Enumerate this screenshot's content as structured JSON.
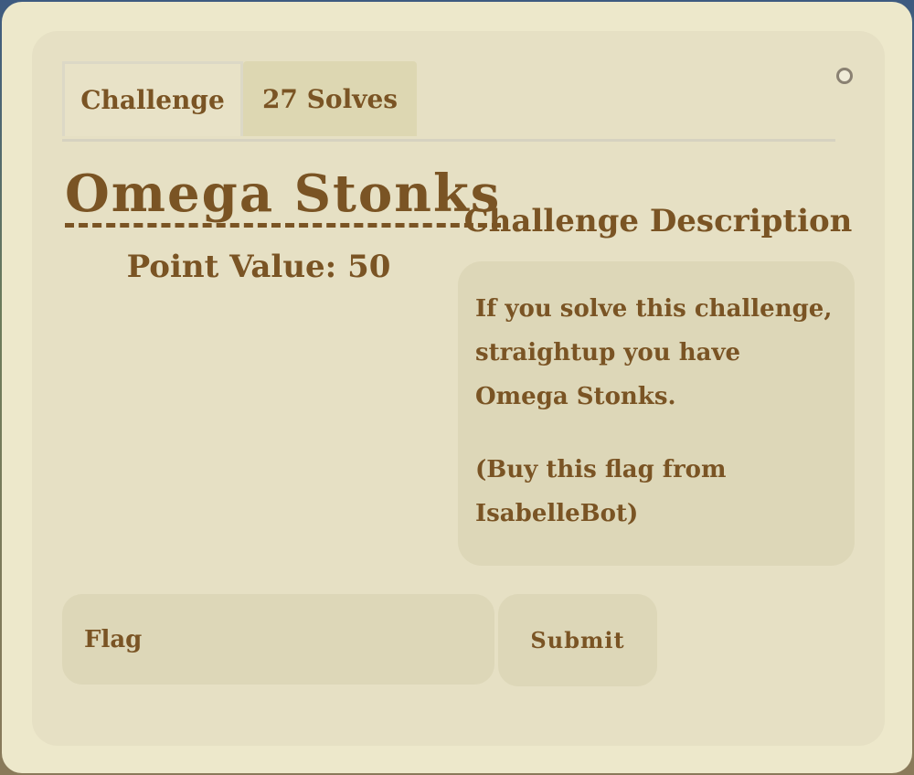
{
  "tabs": [
    {
      "label": "Challenge"
    },
    {
      "label": "27 Solves"
    }
  ],
  "challenge": {
    "title": "Omega Stonks",
    "point_value": "Point Value: 50"
  },
  "description": {
    "heading": "Challenge Description",
    "paragraphs": [
      "If you solve this challenge, straightup you have Omega Stonks.",
      "(Buy this flag from IsabelleBot)"
    ]
  },
  "form": {
    "flag_placeholder": "Flag",
    "submit_label": "Submit"
  },
  "colors": {
    "text": "#7a5424",
    "panel": "#e6e0c4",
    "box": "#ddd7b8"
  },
  "icons": {
    "close": "close-icon"
  }
}
